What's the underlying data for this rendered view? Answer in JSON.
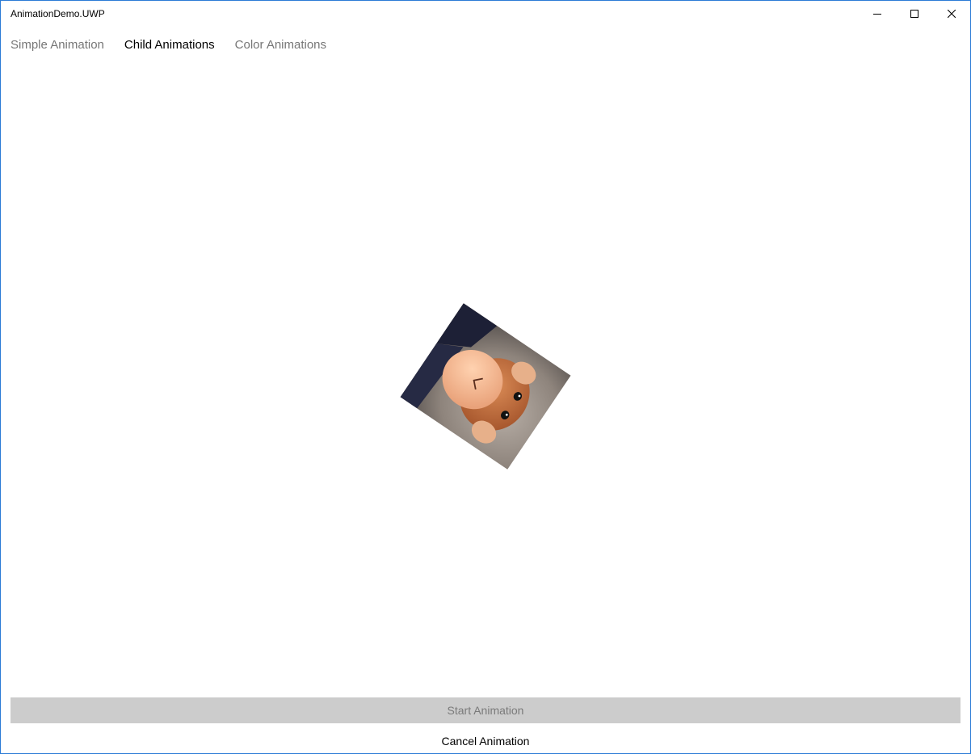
{
  "window": {
    "title": "AnimationDemo.UWP",
    "accent_border": "#2b7bd6",
    "caption_buttons": [
      "minimize-icon",
      "maximize-icon",
      "close-icon"
    ]
  },
  "pivot": {
    "tabs": [
      {
        "label": "Simple Animation",
        "active": false
      },
      {
        "label": "Child Animations",
        "active": true
      },
      {
        "label": "Color Animations",
        "active": false
      }
    ]
  },
  "content": {
    "image_subject": "monkey-plush-photo",
    "rotation_degrees": 34
  },
  "actions": {
    "start_label": "Start Animation",
    "start_enabled": false,
    "cancel_label": "Cancel Animation"
  }
}
